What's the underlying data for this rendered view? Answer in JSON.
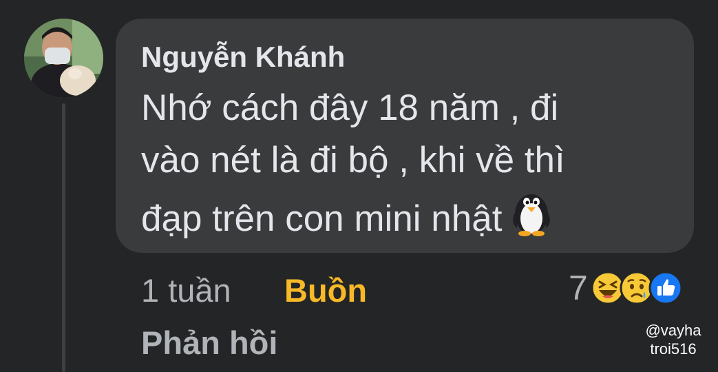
{
  "comment": {
    "author": "Nguyễn Khánh",
    "lines": [
      "Nhớ cách đây 18 năm , đi",
      "vào nét là đi bộ , khi về thì",
      "đạp trên con mini nhật"
    ],
    "emoji": "penguin-icon"
  },
  "meta": {
    "time": "1 tuần",
    "reaction": "Buồn",
    "reply": "Phản hồi"
  },
  "reactions": {
    "count": "7",
    "icons": [
      "haha-icon",
      "sad-icon",
      "like-icon"
    ]
  },
  "watermark": {
    "line1": "@vayha",
    "line2": "troi516"
  },
  "colors": {
    "background": "#242526",
    "bubble": "#3a3b3c",
    "reaction_label": "#f7b928",
    "like_blue": "#1877f2"
  }
}
